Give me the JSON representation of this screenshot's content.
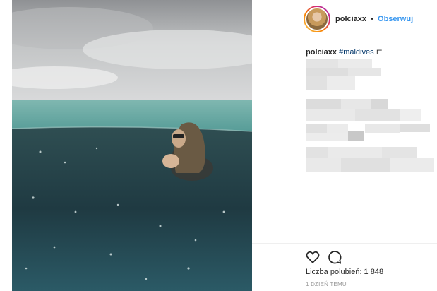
{
  "post": {
    "username": "polciaxx",
    "separator": "•",
    "follow_label": "Obserwuj"
  },
  "caption": {
    "username": "polciaxx",
    "hashtag": "#maldives",
    "emoji": "⊏"
  },
  "engagement": {
    "likes_text": "Liczba polubień: 1 848",
    "time_text": "1 DZIEŃ TEMU"
  },
  "colors": {
    "follow": "#3897f0",
    "hashtag": "#003569",
    "border": "#efefef"
  },
  "icons": [
    "heart-icon",
    "comment-icon"
  ]
}
